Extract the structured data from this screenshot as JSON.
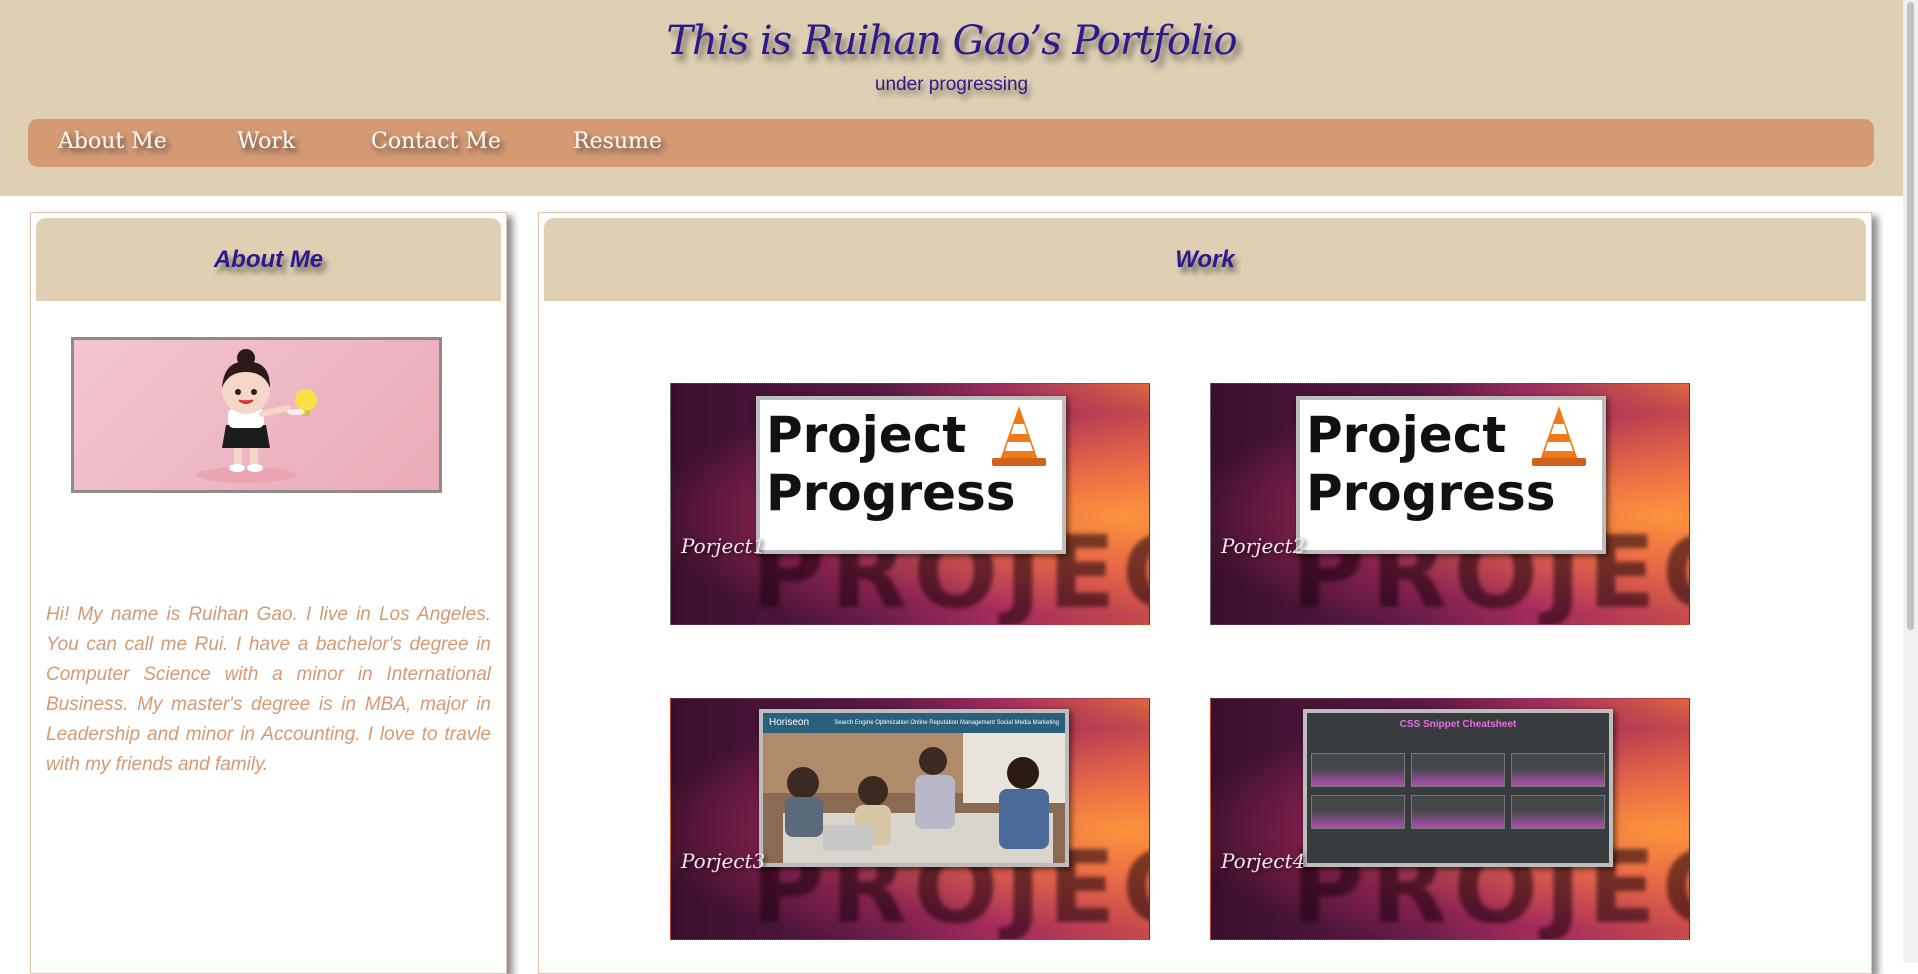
{
  "header": {
    "title": "This is Ruihan Gao’s Portfolio",
    "subtitle": "under progressing"
  },
  "nav": {
    "items": [
      "About Me",
      "Work",
      "Contact Me",
      "Resume"
    ]
  },
  "about": {
    "heading": "About Me",
    "bio": "Hi! My name is Ruihan Gao. I live in Los Angeles. You can call me Rui. I have a bachelor's degree in Computer Science with a minor in International Business. My master's degree is in MBA, major in Leadership and minor in Accounting. I love to travle with my friends and family."
  },
  "work": {
    "heading": "Work",
    "projects": [
      {
        "label": "Porject1",
        "thumb_text_1": "Project",
        "thumb_text_2": "Progress"
      },
      {
        "label": "Porject2",
        "thumb_text_1": "Project",
        "thumb_text_2": "Progress"
      },
      {
        "label": "Porject3",
        "thumb_brand": "Horiseon",
        "thumb_nav": "Search Engine Optimization    Online Reputation Management    Social Media Marketing"
      },
      {
        "label": "Porject4",
        "thumb_title": "CSS Snippet Cheatsheet"
      }
    ],
    "bg_word": "PROJECTS"
  },
  "colors": {
    "header_bg": "#dfd0b4",
    "nav_bg": "#d39a74",
    "title_text": "#2e1a8a",
    "bio_text": "#d39a74"
  }
}
